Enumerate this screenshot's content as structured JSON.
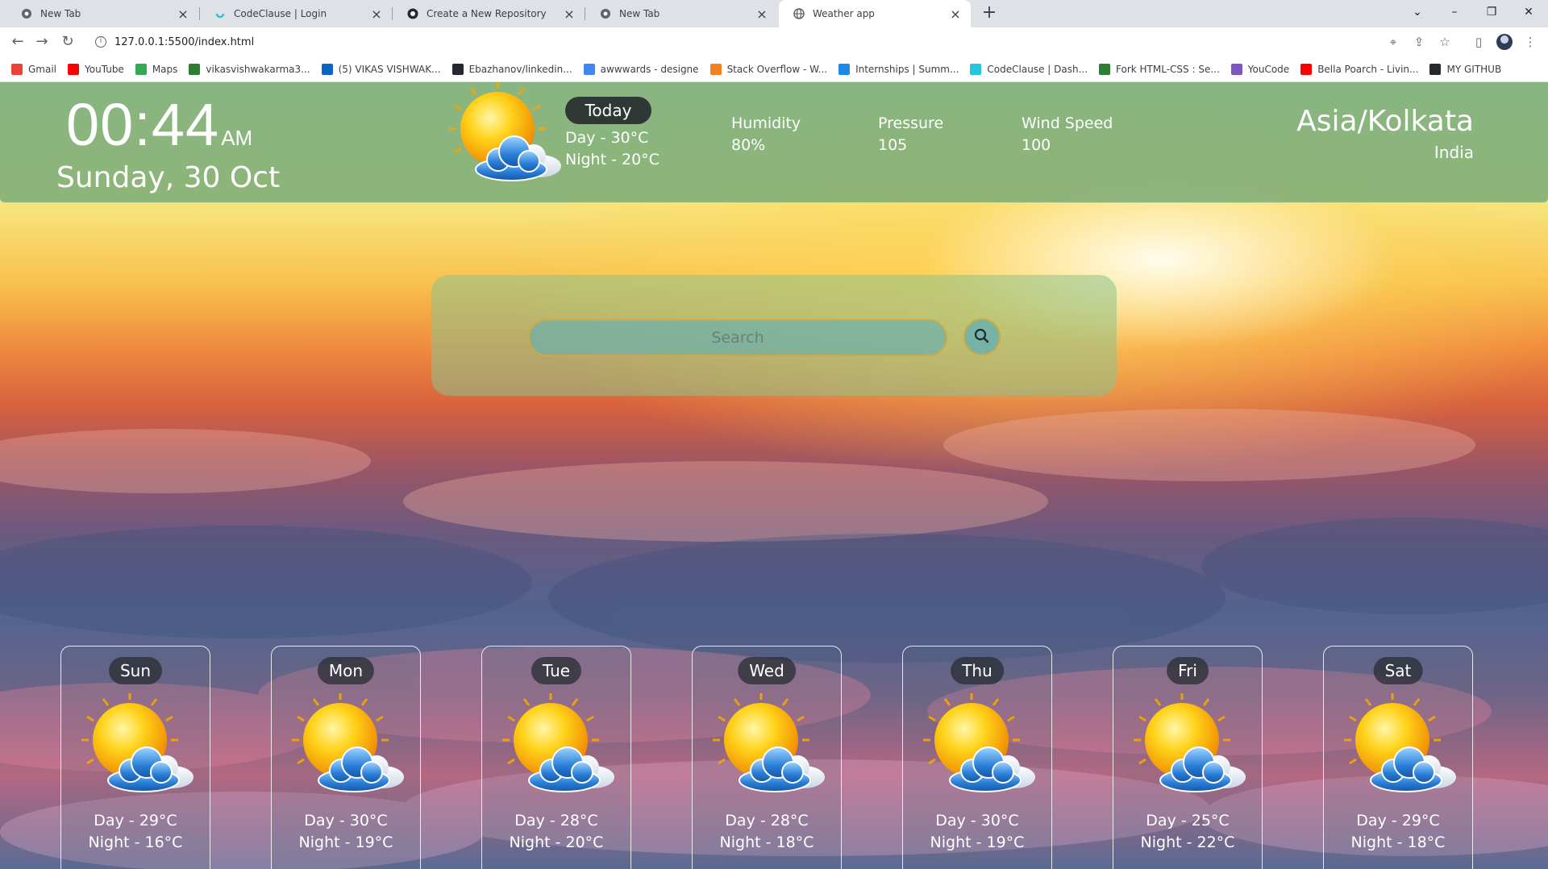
{
  "browser": {
    "tabs": [
      {
        "title": "New Tab",
        "active": false
      },
      {
        "title": "CodeClause | Login",
        "active": false
      },
      {
        "title": "Create a New Repository",
        "active": false
      },
      {
        "title": "New Tab",
        "active": false
      },
      {
        "title": "Weather app",
        "active": true
      }
    ],
    "url": "127.0.0.1:5500/index.html",
    "bookmarks": [
      {
        "label": "Gmail",
        "color": "#ea4335"
      },
      {
        "label": "YouTube",
        "color": "#ff0000"
      },
      {
        "label": "Maps",
        "color": "#34a853"
      },
      {
        "label": "vikasvishwakarma3...",
        "color": "#2e7d32"
      },
      {
        "label": "(5) VIKAS VISHWAK...",
        "color": "#0a66c2"
      },
      {
        "label": "Ebazhanov/linkedin...",
        "color": "#24292f"
      },
      {
        "label": "awwwards - designe",
        "color": "#4285f4"
      },
      {
        "label": "Stack Overflow - W...",
        "color": "#f48024"
      },
      {
        "label": "Internships | Summ...",
        "color": "#1e88e5"
      },
      {
        "label": "CodeClause | Dash...",
        "color": "#26c6da"
      },
      {
        "label": "Fork HTML-CSS : Se...",
        "color": "#2e7d32"
      },
      {
        "label": "YouCode",
        "color": "#7e57c2"
      },
      {
        "label": "Bella Poarch - Livin...",
        "color": "#ff0000"
      },
      {
        "label": "MY GITHUB",
        "color": "#24292f"
      }
    ]
  },
  "header": {
    "time": "00:44",
    "ampm": "AM",
    "date": "Sunday, 30 Oct",
    "today": {
      "label": "Today",
      "day": "Day - 30°C",
      "night": "Night - 20°C"
    },
    "stats": [
      {
        "label": "Humidity",
        "value": "80%"
      },
      {
        "label": "Pressure",
        "value": "105"
      },
      {
        "label": "Wind Speed",
        "value": "100"
      }
    ],
    "timezone": "Asia/Kolkata",
    "country": "India"
  },
  "search": {
    "placeholder": "Search",
    "icon": "search-icon"
  },
  "forecast": [
    {
      "day": "Sun",
      "temp_day": "Day - 29°C",
      "temp_night": "Night - 16°C"
    },
    {
      "day": "Mon",
      "temp_day": "Day - 30°C",
      "temp_night": "Night - 19°C"
    },
    {
      "day": "Tue",
      "temp_day": "Day - 28°C",
      "temp_night": "Night - 20°C"
    },
    {
      "day": "Wed",
      "temp_day": "Day - 28°C",
      "temp_night": "Night - 18°C"
    },
    {
      "day": "Thu",
      "temp_day": "Day - 30°C",
      "temp_night": "Night - 19°C"
    },
    {
      "day": "Fri",
      "temp_day": "Day - 25°C",
      "temp_night": "Night - 22°C"
    },
    {
      "day": "Sat",
      "temp_day": "Day - 29°C",
      "temp_night": "Night - 18°C"
    }
  ],
  "colors": {
    "header_bg": "#76aa78",
    "badge_bg": "#2f3834",
    "search_border": "#d2aa3c"
  }
}
